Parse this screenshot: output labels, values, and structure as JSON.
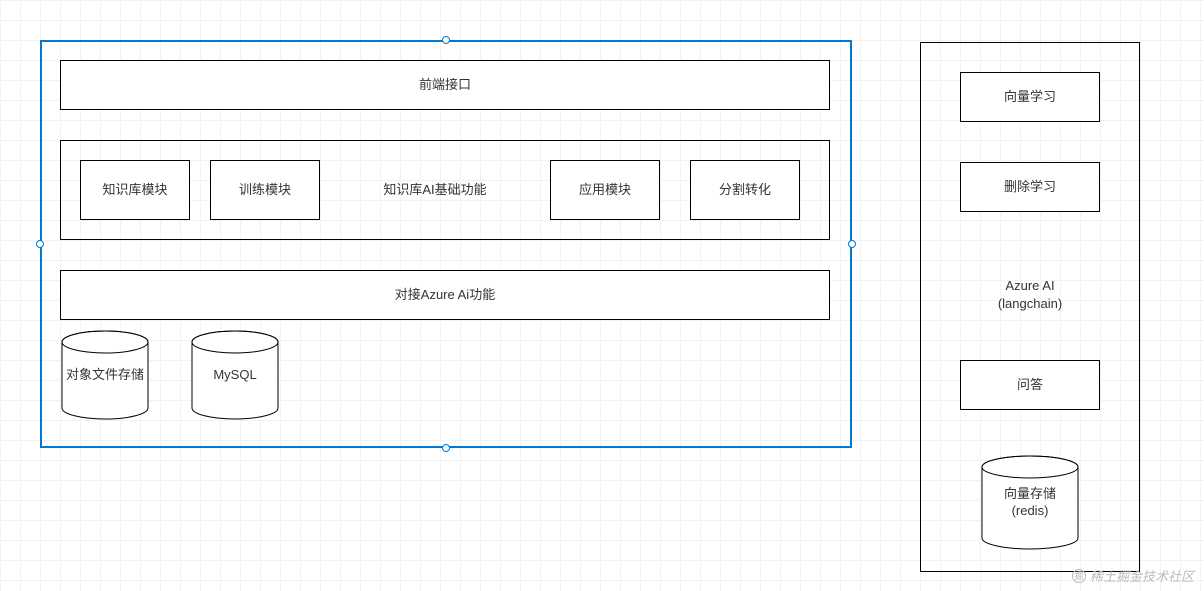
{
  "main": {
    "frontend": "前端接口",
    "middle": {
      "kb_module": "知识库模块",
      "train_module": "训练模块",
      "kb_ai_base": "知识库AI基础功能",
      "app_module": "应用模块",
      "split_convert": "分割转化"
    },
    "azure_connect": "对接Azure Ai功能",
    "storage": {
      "object_file": "对象文件存储",
      "mysql": "MySQL"
    }
  },
  "side": {
    "vector_learn": "向量学习",
    "delete_learn": "删除学习",
    "azure_ai": "Azure AI\n(langchain)",
    "qa": "问答",
    "vector_store": "向量存储\n(redis)"
  },
  "watermark": "稀土掘金技术社区"
}
